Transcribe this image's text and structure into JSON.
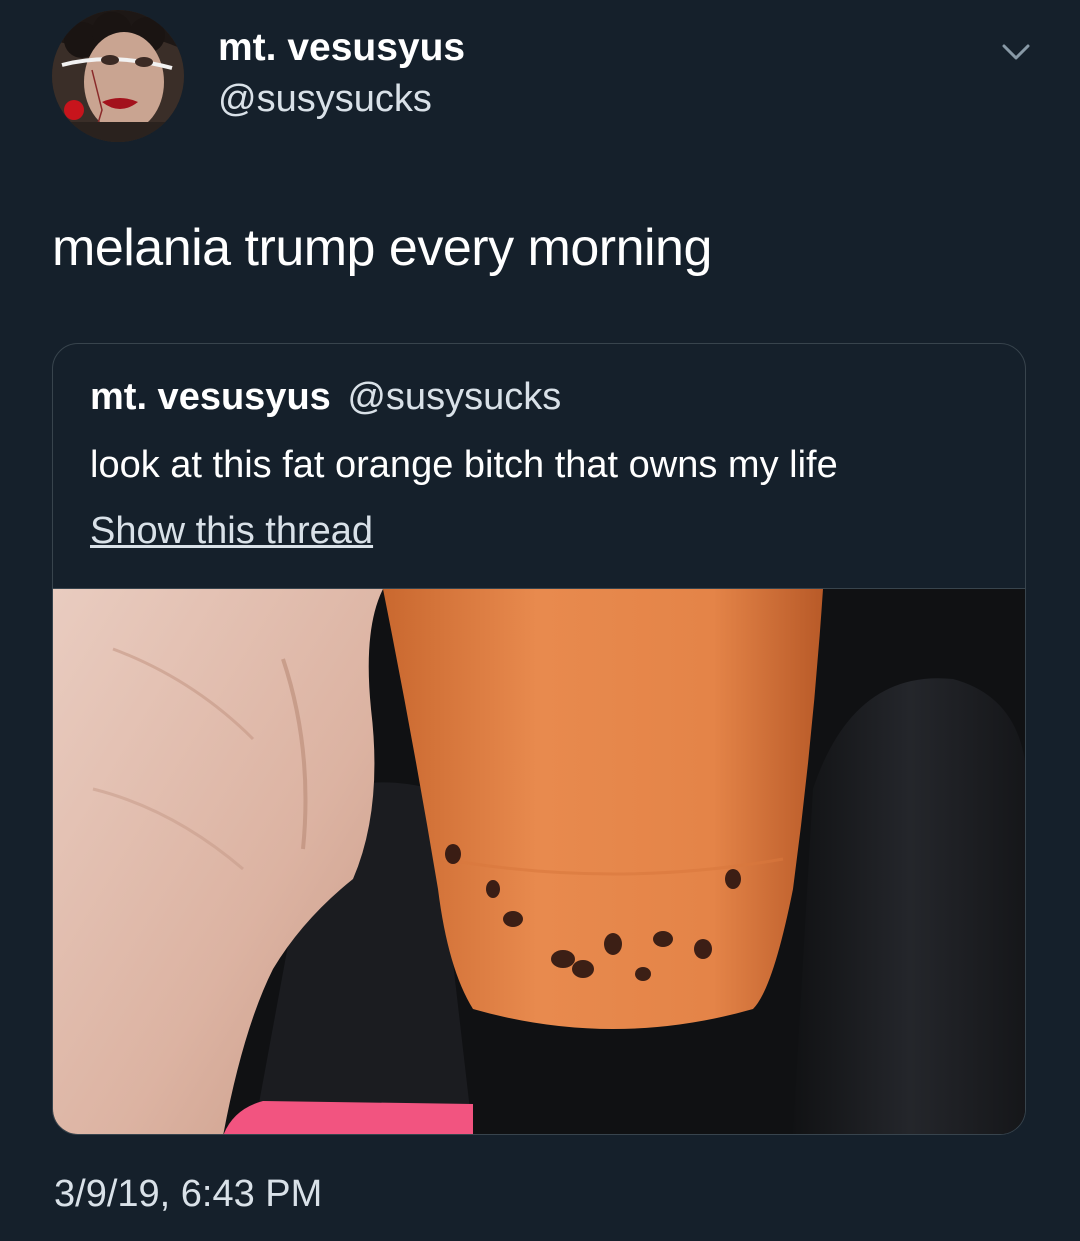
{
  "tweet": {
    "author": {
      "display_name": "mt. vesusyus",
      "handle": "@susysucks",
      "avatar_icon": "profile-photo"
    },
    "menu_icon": "chevron-down-icon",
    "text": "melania trump every morning",
    "timestamp": "3/9/19, 6:43 PM"
  },
  "quoted_tweet": {
    "display_name": "mt. vesusyus",
    "handle": "@susysucks",
    "text": "look at this fat orange bitch that owns my life",
    "show_thread_label": "Show this thread",
    "media_icon": "photo-bubble-tea-cup"
  },
  "colors": {
    "background": "#15202b",
    "border": "#38444d",
    "primary_text": "#ffffff",
    "secondary_text": "#d9e1e8",
    "drink_orange": "#e88a4e"
  }
}
